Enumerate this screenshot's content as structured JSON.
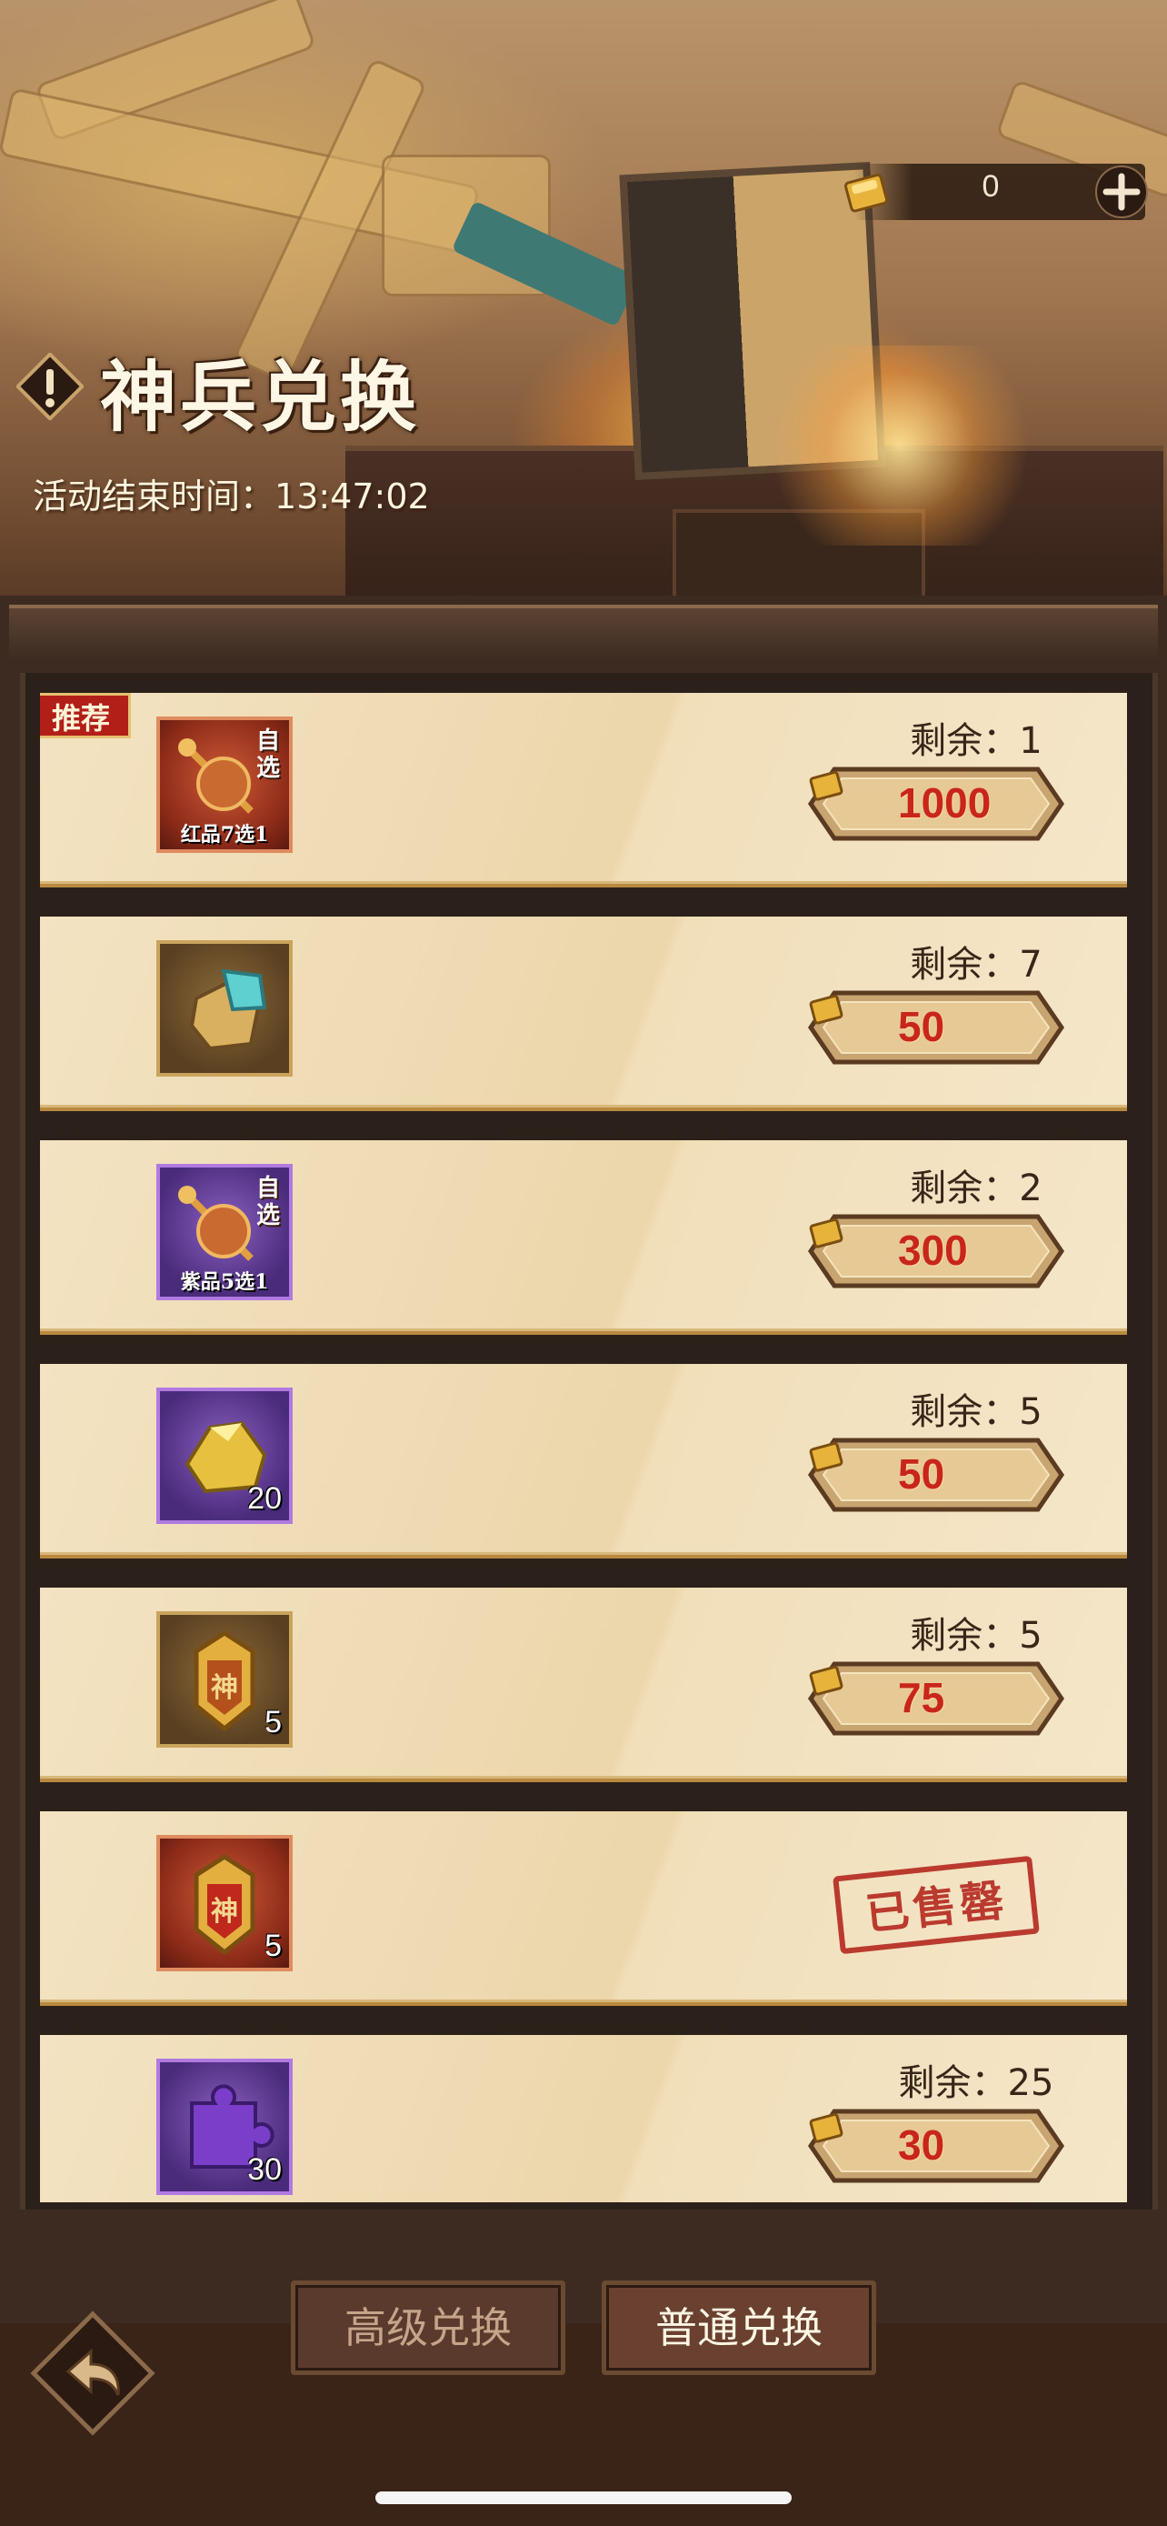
{
  "header": {
    "title": "神兵兑换",
    "timer_label": "活动结束时间：",
    "timer_value": "13:47:02",
    "currency": {
      "icon": "gold-ingot-icon",
      "value": "0"
    }
  },
  "items": [
    {
      "remaining_label": "剩余：",
      "remaining": "1",
      "price": "1000",
      "sold_out": false,
      "badge": "推荐",
      "icon": {
        "name": "red-weapon-chest-icon",
        "tag": "自选",
        "caption": "红品7选1",
        "count": ""
      }
    },
    {
      "remaining_label": "剩余：",
      "remaining": "7",
      "price": "50",
      "sold_out": false,
      "icon": {
        "name": "cyan-ore-icon",
        "tag": "",
        "caption": "",
        "count": ""
      }
    },
    {
      "remaining_label": "剩余：",
      "remaining": "2",
      "price": "300",
      "sold_out": false,
      "icon": {
        "name": "purple-weapon-chest-icon",
        "tag": "自选",
        "caption": "紫品5选1",
        "count": ""
      }
    },
    {
      "remaining_label": "剩余：",
      "remaining": "5",
      "price": "50",
      "sold_out": false,
      "icon": {
        "name": "gold-ore-icon",
        "tag": "",
        "caption": "",
        "count": "20"
      }
    },
    {
      "remaining_label": "剩余：",
      "remaining": "5",
      "price": "75",
      "sold_out": false,
      "icon": {
        "name": "gold-divine-token-icon",
        "tag": "",
        "caption": "",
        "count": "5"
      }
    },
    {
      "sold_out": true,
      "sold_out_text": "已售罄",
      "icon": {
        "name": "red-divine-token-icon",
        "tag": "",
        "caption": "",
        "count": "5"
      }
    },
    {
      "remaining_label": "剩余：",
      "remaining": "25",
      "price": "30",
      "sold_out": false,
      "icon": {
        "name": "purple-puzzle-piece-icon",
        "tag": "",
        "caption": "",
        "count": "30"
      }
    }
  ],
  "tabs": {
    "premium": "高级兑换",
    "normal": "普通兑换"
  },
  "icons": {
    "back": "back-arrow-icon",
    "plus": "plus-icon",
    "info": "exclamation-icon"
  },
  "colors": {
    "price_red": "#c8261a",
    "row_bg": "#f1dfba",
    "gold_border": "#b8893e"
  }
}
